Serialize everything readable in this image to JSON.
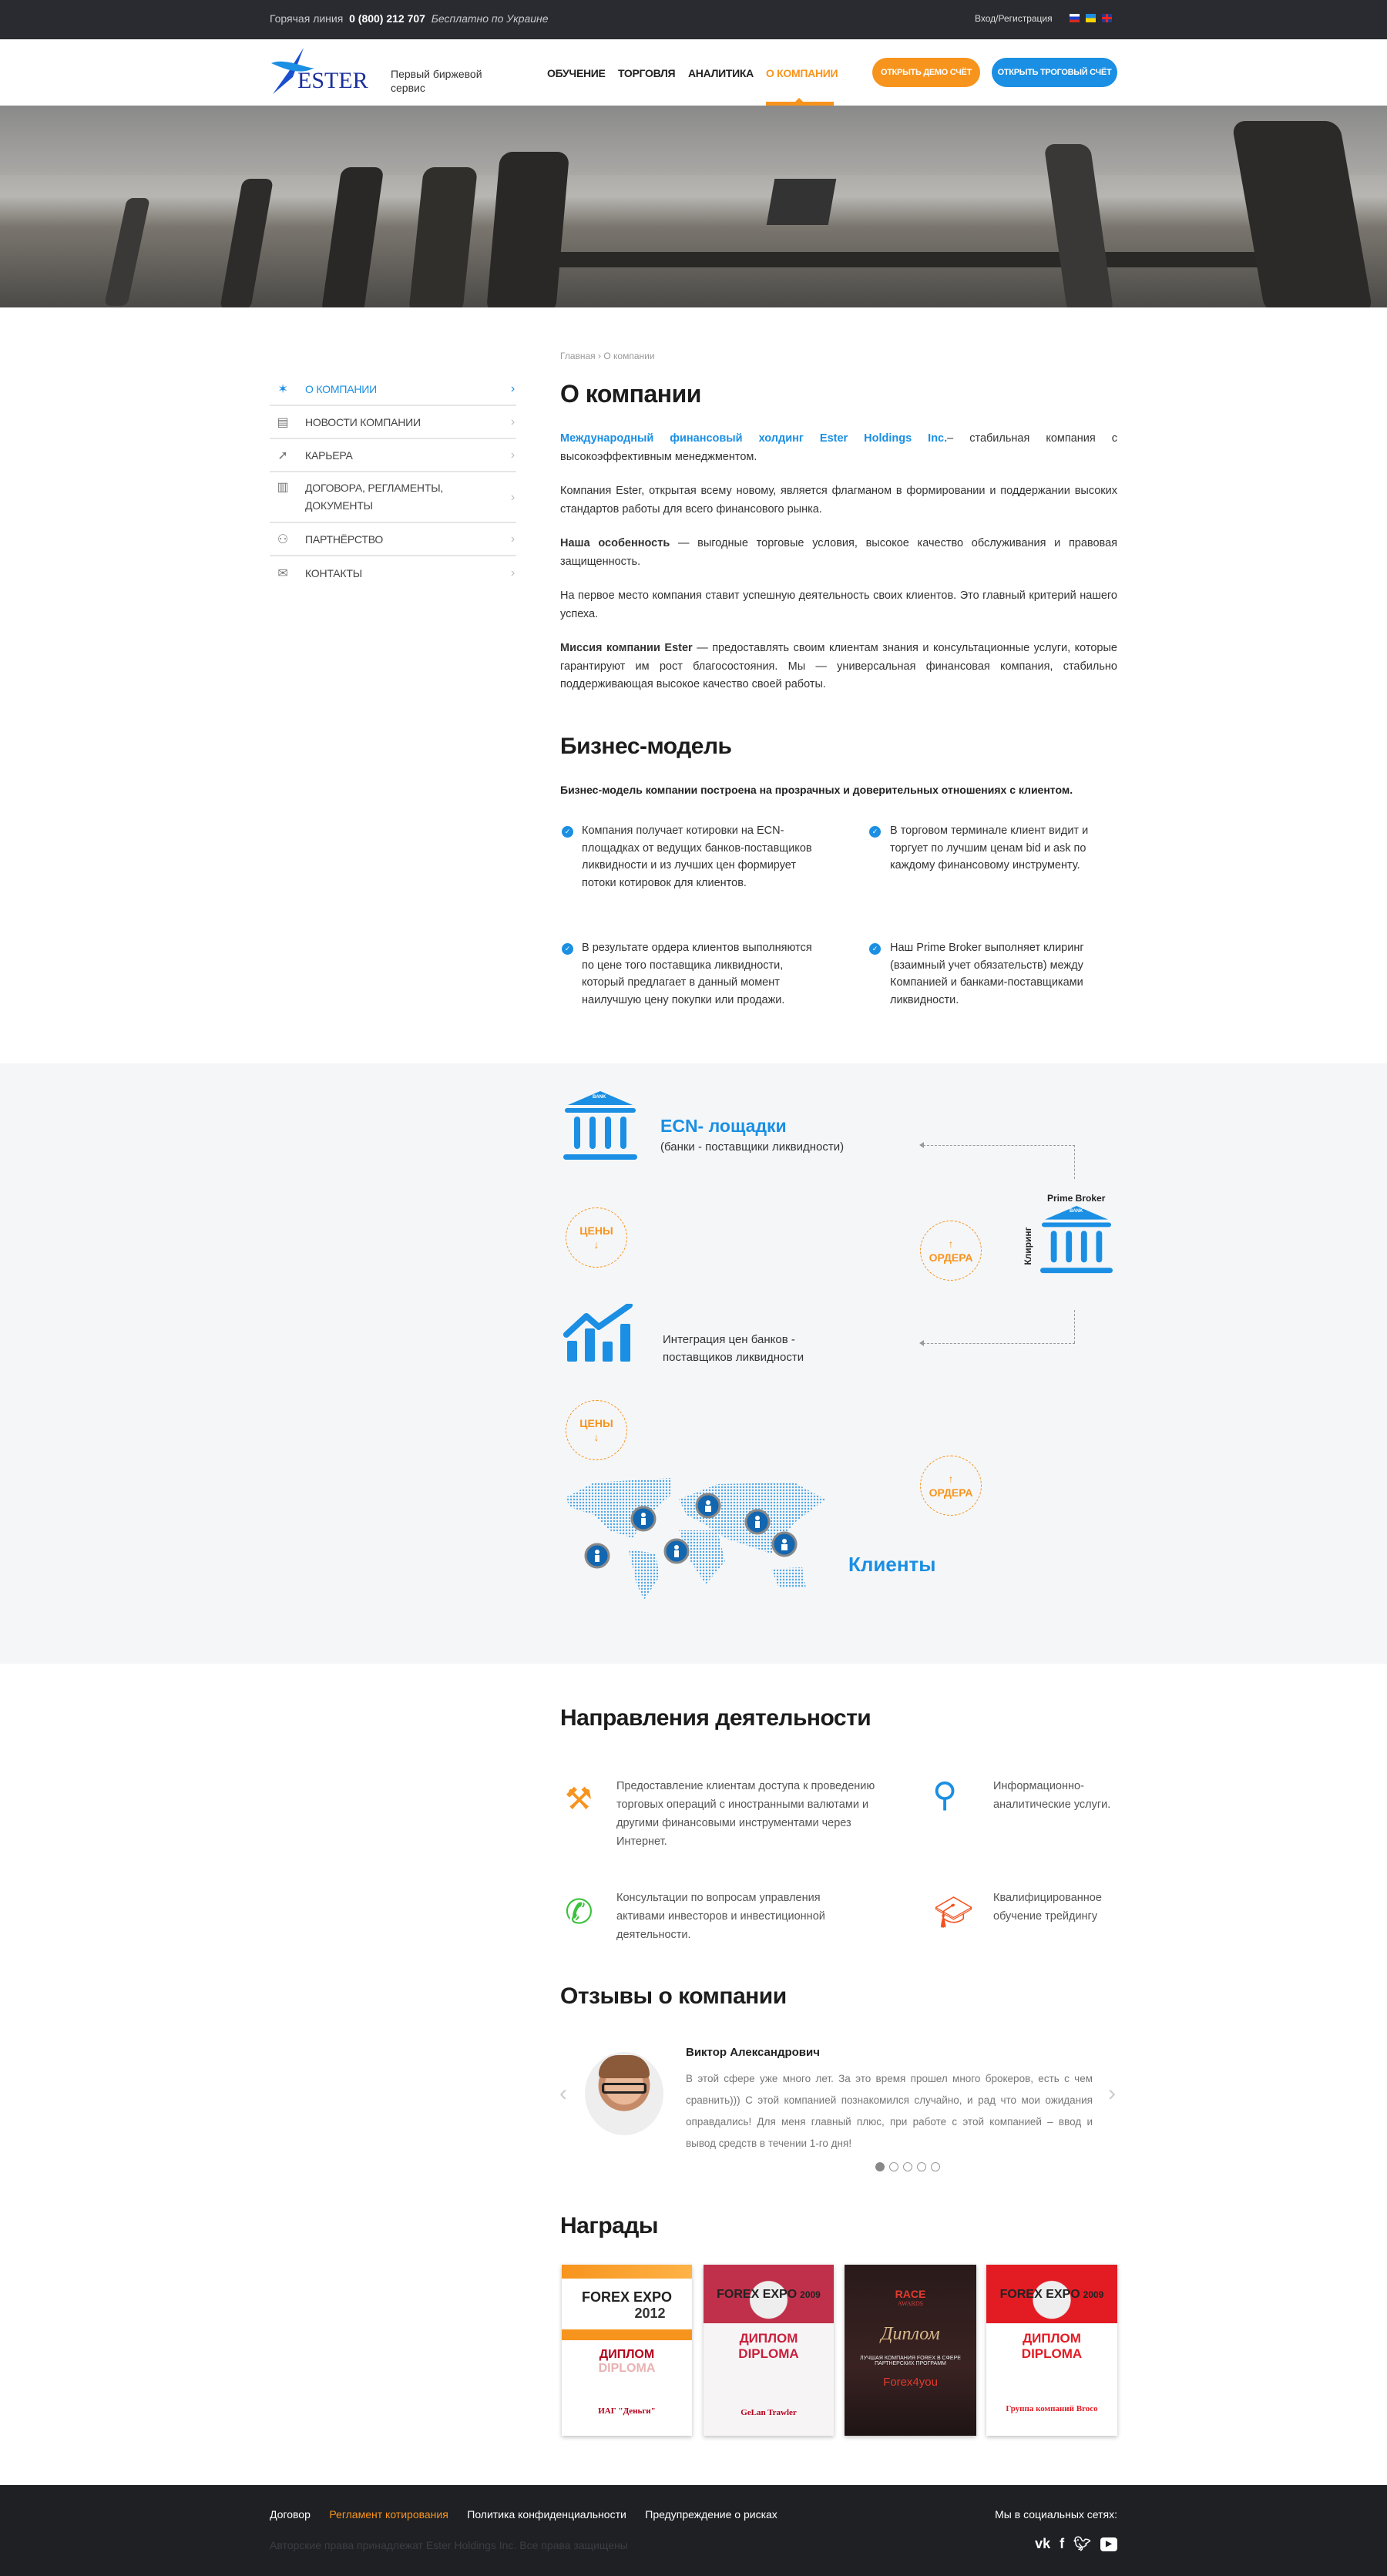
{
  "topbar": {
    "hotline_label": "Горячая линия",
    "phone": "0 (800) 212 707",
    "free_note": "Бесплатно по Украине",
    "login": "Вход/Регистрация",
    "languages": [
      "ru",
      "ua",
      "en"
    ]
  },
  "header": {
    "logo_text": "ESTER",
    "tagline_1": "Первый биржевой",
    "tagline_2": "сервис",
    "nav": [
      {
        "label": "ОБУЧЕНИЕ"
      },
      {
        "label": "ТОРГОВЛЯ"
      },
      {
        "label": "АНАЛИТИКА"
      },
      {
        "label": "О КОМПАНИИ",
        "active": true
      }
    ],
    "demo_button": "ОТКРЫТЬ ДЕМО СЧЁТ",
    "trade_button": "ОТКРЫТЬ ТРОГОВЫЙ СЧЁТ"
  },
  "colors": {
    "accent_blue": "#1a8fe3",
    "accent_orange": "#f7941d",
    "dark": "#2a2b30"
  },
  "breadcrumb": {
    "home": "Главная",
    "separator": "›",
    "current": "О компании"
  },
  "sidebar": {
    "items": [
      {
        "label": "О КОМПАНИИ",
        "icon": "star-logo-icon",
        "active": true
      },
      {
        "label": "НОВОСТИ КОМПАНИИ",
        "icon": "newspaper-icon"
      },
      {
        "label": "КАРЬЕРА",
        "icon": "rocket-icon"
      },
      {
        "label": "ДОГОВОРА, РЕГЛАМЕНТЫ,",
        "label2": "ДОКУМЕНТЫ",
        "icon": "book-icon"
      },
      {
        "label": "ПАРТНЁРСТВО",
        "icon": "people-icon"
      },
      {
        "label": "КОНТАКТЫ",
        "icon": "envelope-icon"
      }
    ]
  },
  "about": {
    "title": "О компании",
    "p1_link": "Международный финансовый холдинг  Ester Holdings Inc.",
    "p1_rest": "– стабильная компания с высокоэффективным менеджментом.",
    "p2": "Компания Ester, открытая  всему новому, является флагманом в формировании и  поддержании высоких стандартов работы для всего финансового рынка.",
    "p3_bold": "Наша особенность",
    "p3_rest": " — выгодные торговые условия, высокое качество обслуживания и  правовая защищенность.",
    "p4": "На первое место компания ставит успешную деятельность своих клиентов. Это главный  критерий нашего успеха.",
    "p5_bold": "Миссия компании Ester",
    "p5_rest": " — предоставлять своим клиентам знания и консультационные услуги, которые гарантируют им рост благосостояния. Мы — универсальная финансовая компания, стабильно поддерживающая высокое качество своей работы."
  },
  "business": {
    "title": "Бизнес-модель",
    "subtitle": "Бизнес-модель компании построена на прозрачных и доверительных отношениях с клиентом.",
    "bullets": [
      "Компания получает котировки на ECN-площадках от ведущих банков-поставщиков ликвидности и из лучших цен формирует потоки котировок для клиентов.",
      "В торговом терминале клиент видит и торгует по лучшим ценам bid и ask по каждому финансовому инструменту.",
      "В результате ордера клиентов выполняются по цене того поставщика ликвидности,  который предлагает в данный момент наилучшую цену покупки или продажи.",
      " Наш Prime Broker выполняет клиринг (взаимный учет обязательств) между Компанией и банками-поставщиками ликвидности."
    ]
  },
  "diagram": {
    "bank_label": "BANK",
    "ecn_title": "ECN- лощадки",
    "ecn_subtitle": "(банки - поставщики ликвидности)",
    "prices": "ЦЕНЫ",
    "orders": "ОРДЕРА",
    "arrow_down": "↓",
    "arrow_up": "↑",
    "prime_broker": "Prime Broker",
    "clearing": "Клиринг",
    "integration_1": "Интеграция цен банков -",
    "integration_2": "поставщиков ликвидности",
    "clients": "Клиенты"
  },
  "directions": {
    "title": "Направления деятельности",
    "items": [
      {
        "text": "Предоставление клиентам доступа к проведению торговых операций с иностранными валютами и другими финансовыми инструментами через Интернет.",
        "icon": "hammer-icon",
        "color": "#f7941d"
      },
      {
        "text": "Информационно-аналитические услуги.",
        "icon": "magnifier-chart-icon",
        "color": "#1a8fe3"
      },
      {
        "text": "Консультации по вопросам управления активами инвесторов и инвестиционной деятельности.",
        "icon": "phone-icon",
        "color": "#3cc23c"
      },
      {
        "text": "Квалифицированное обучение трейдингу",
        "icon": "graduation-cap-icon",
        "color": "#f4511e"
      }
    ]
  },
  "reviews": {
    "title": "Отзывы о компании",
    "name": "Виктор Александрович",
    "text": "В этой сфере уже много лет.  За это время прошел много брокеров, есть с чем сравнить))) С этой компанией познакомился случайно, и рад что мои ожидания оправдались! Для меня главный плюс, при работе с этой компанией – ввод и вывод средств в течении 1-го дня!",
    "slides": 5,
    "active_slide": 1
  },
  "awards": {
    "title": "Награды",
    "items": [
      {
        "event": "FOREX EXPO",
        "year": "2012",
        "ru": "ДИПЛОМ",
        "en": "DIPLOMA",
        "winner": "ИАГ \"Деньги\""
      },
      {
        "event": "FOREX EXPO",
        "year": "2009",
        "ru": "ДИПЛОМ",
        "en": "DIPLOMA",
        "winner": "GeLan Trawler"
      },
      {
        "event": "RACE",
        "year": "AWARDS",
        "ru": "Диплом",
        "en": "ЛУЧШАЯ КОМПАНИЯ FOREX В СФЕРЕ ПАРТНЕРСКИХ ПРОГРАММ",
        "winner": "Forex4you"
      },
      {
        "event": "FOREX EXPO",
        "year": "2009",
        "ru": "ДИПЛОМ",
        "en": "DIPLOMA",
        "winner": "Группа компаний Broco"
      }
    ]
  },
  "footer": {
    "links": [
      "Договор",
      "Регламент котирования",
      "Политика конфиденциальности",
      "Предупреждение о рисках"
    ],
    "active_link": 1,
    "copyright": "Авторские права принадлежат  Ester Holdings Inc. Все права защищены",
    "social_label": "Мы в социальных сетях:",
    "social": [
      "vk",
      "f",
      "twitter",
      "youtube"
    ]
  }
}
